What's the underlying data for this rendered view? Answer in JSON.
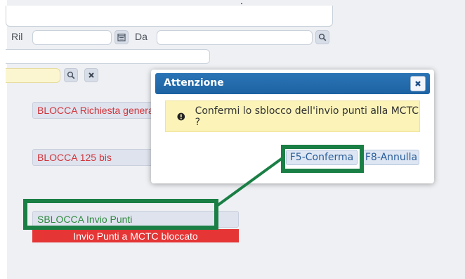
{
  "form": {
    "ril_label": "Ril",
    "da_label": "Da"
  },
  "icons": {
    "search": "search-icon",
    "clear": "close-icon",
    "calendar": "calendar-icon",
    "warning": "warning-icon"
  },
  "buttons": {
    "blocca_richiesta": "BLOCCA Richiesta genera",
    "blocca_125bis": "BLOCCA 125 bis",
    "sblocca_invio": "SBLOCCA Invio Punti"
  },
  "status": {
    "invio_bloccato": "Invio Punti a MCTC bloccato"
  },
  "dialog": {
    "title": "Attenzione",
    "message": "Confermi lo sblocco dell'invio punti alla MCTC ?",
    "confirm_label": "F5-Conferma",
    "cancel_label": "F8-Annulla"
  },
  "colors": {
    "dialog_header": "#1d63a3",
    "danger_text": "#d1343a",
    "success_text": "#2f8a3f",
    "status_bar": "#e53535",
    "annotation": "#1a7f45",
    "message_bg": "#fbf3b8"
  }
}
